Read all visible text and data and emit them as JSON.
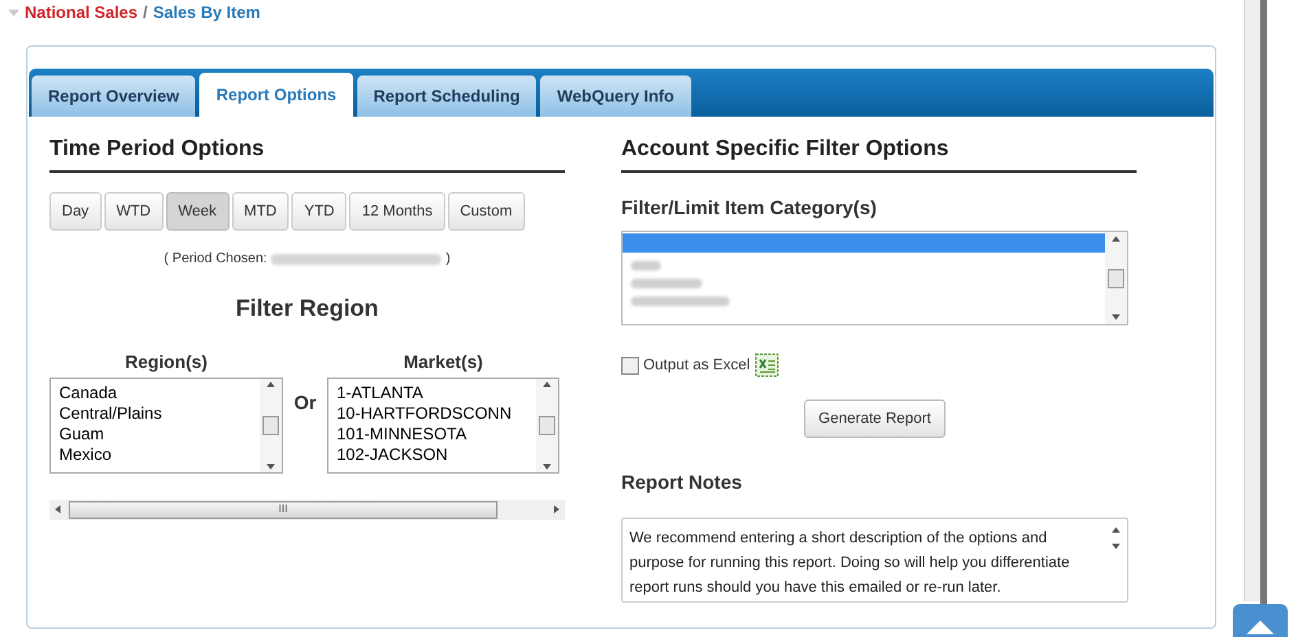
{
  "breadcrumb": {
    "parent": "National Sales",
    "separator": "/",
    "current": "Sales By Item"
  },
  "tabs": [
    {
      "label": "Report Overview",
      "selected": false
    },
    {
      "label": "Report Options",
      "selected": true
    },
    {
      "label": "Report Scheduling",
      "selected": false
    },
    {
      "label": "WebQuery Info",
      "selected": false
    }
  ],
  "time_period": {
    "title": "Time Period Options",
    "buttons": [
      {
        "label": "Day",
        "selected": false
      },
      {
        "label": "WTD",
        "selected": false
      },
      {
        "label": "Week",
        "selected": true
      },
      {
        "label": "MTD",
        "selected": false
      },
      {
        "label": "YTD",
        "selected": false
      },
      {
        "label": "12 Months",
        "selected": false
      },
      {
        "label": "Custom",
        "selected": false
      }
    ],
    "period_open": "( Period Chosen:",
    "period_close": ")"
  },
  "filter_region": {
    "title": "Filter Region",
    "regions_label": "Region(s)",
    "regions": [
      "Canada",
      "Central/Plains",
      "Guam",
      "Mexico"
    ],
    "or_label": "Or",
    "markets_label": "Market(s)",
    "markets": [
      "1-ATLANTA",
      "10-HARTFORDSCONN",
      "101-MINNESOTA",
      "102-JACKSON"
    ],
    "scroll_grip": "III"
  },
  "account_filter": {
    "title": "Account Specific Filter Options",
    "category_label": "Filter/Limit Item Category(s)",
    "output_excel": {
      "label": "Output as Excel",
      "checked": false
    },
    "generate_button": "Generate Report"
  },
  "report_notes": {
    "title": "Report Notes",
    "text": "We recommend entering a short description of the options and purpose for running this report. Doing so will help you differentiate report runs should you have this emailed or re-run later."
  }
}
